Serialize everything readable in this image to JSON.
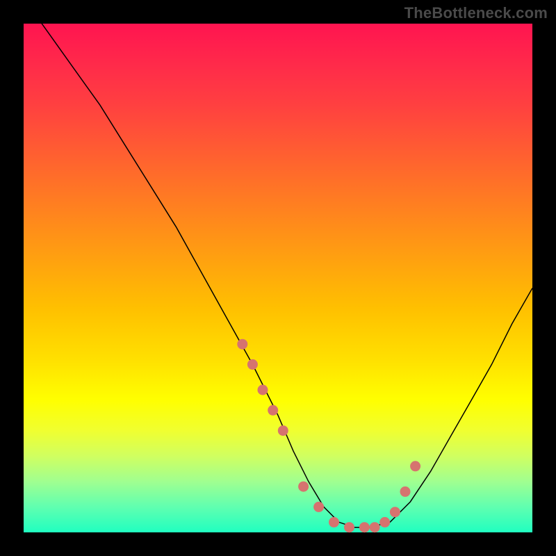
{
  "watermark": "TheBottleneck.com",
  "chart_data": {
    "type": "line",
    "title": "",
    "xlabel": "",
    "ylabel": "",
    "xlim": [
      0,
      100
    ],
    "ylim": [
      0,
      100
    ],
    "series": [
      {
        "name": "bottleneck-curve",
        "x": [
          0,
          5,
          10,
          15,
          20,
          25,
          30,
          35,
          40,
          45,
          50,
          53,
          56,
          59,
          62,
          65,
          68,
          72,
          76,
          80,
          84,
          88,
          92,
          96,
          100
        ],
        "values": [
          105,
          98,
          91,
          84,
          76,
          68,
          60,
          51,
          42,
          33,
          23,
          16,
          10,
          5,
          2,
          1,
          1,
          2,
          6,
          12,
          19,
          26,
          33,
          41,
          48
        ]
      }
    ],
    "highlight_points": {
      "name": "optimal-range-dots",
      "x": [
        43,
        45,
        47,
        49,
        51,
        55,
        58,
        61,
        64,
        67,
        69,
        71,
        73,
        75,
        77
      ],
      "values": [
        37,
        33,
        28,
        24,
        20,
        9,
        5,
        2,
        1,
        1,
        1,
        2,
        4,
        8,
        13
      ]
    },
    "gradient_meaning": "vertical color gradient from red (high bottleneck) at top to green (low bottleneck) at bottom"
  }
}
